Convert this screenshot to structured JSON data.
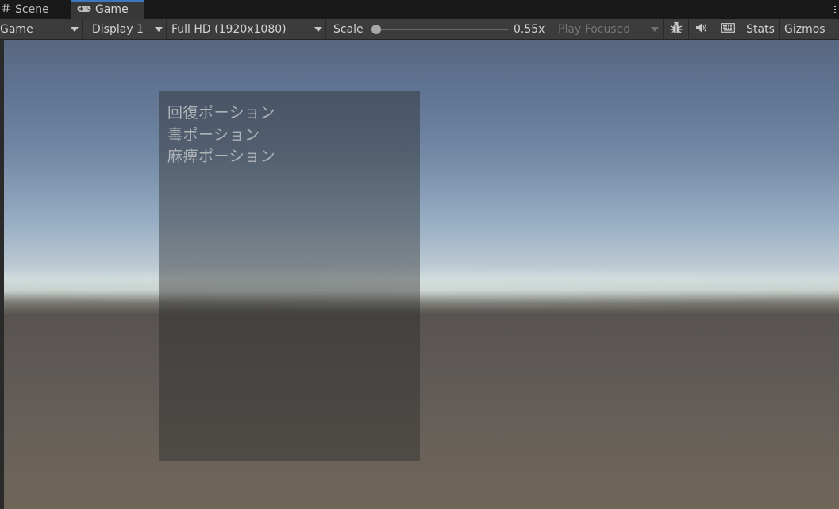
{
  "tabs": [
    {
      "label": "Scene",
      "icon": "hash-icon",
      "active": false
    },
    {
      "label": "Game",
      "icon": "gamepad-icon",
      "active": true
    }
  ],
  "toolbar": {
    "game_dropdown": "Game",
    "display_dropdown": "Display 1",
    "resolution_dropdown": "Full HD (1920x1080)",
    "scale_label": "Scale",
    "scale_value": "0.55x",
    "scale_fraction": 0.0,
    "play_mode_dropdown": "Play Focused",
    "stats_label": "Stats",
    "gizmos_label": "Gizmos"
  },
  "game_view": {
    "items": [
      "回復ポーション",
      "毒ポーション",
      "麻痺ポーション"
    ]
  },
  "colors": {
    "active_tab_accent": "#3a79bb",
    "toolbar_bg": "#3c3c3c",
    "tab_bar_bg": "#191919"
  }
}
